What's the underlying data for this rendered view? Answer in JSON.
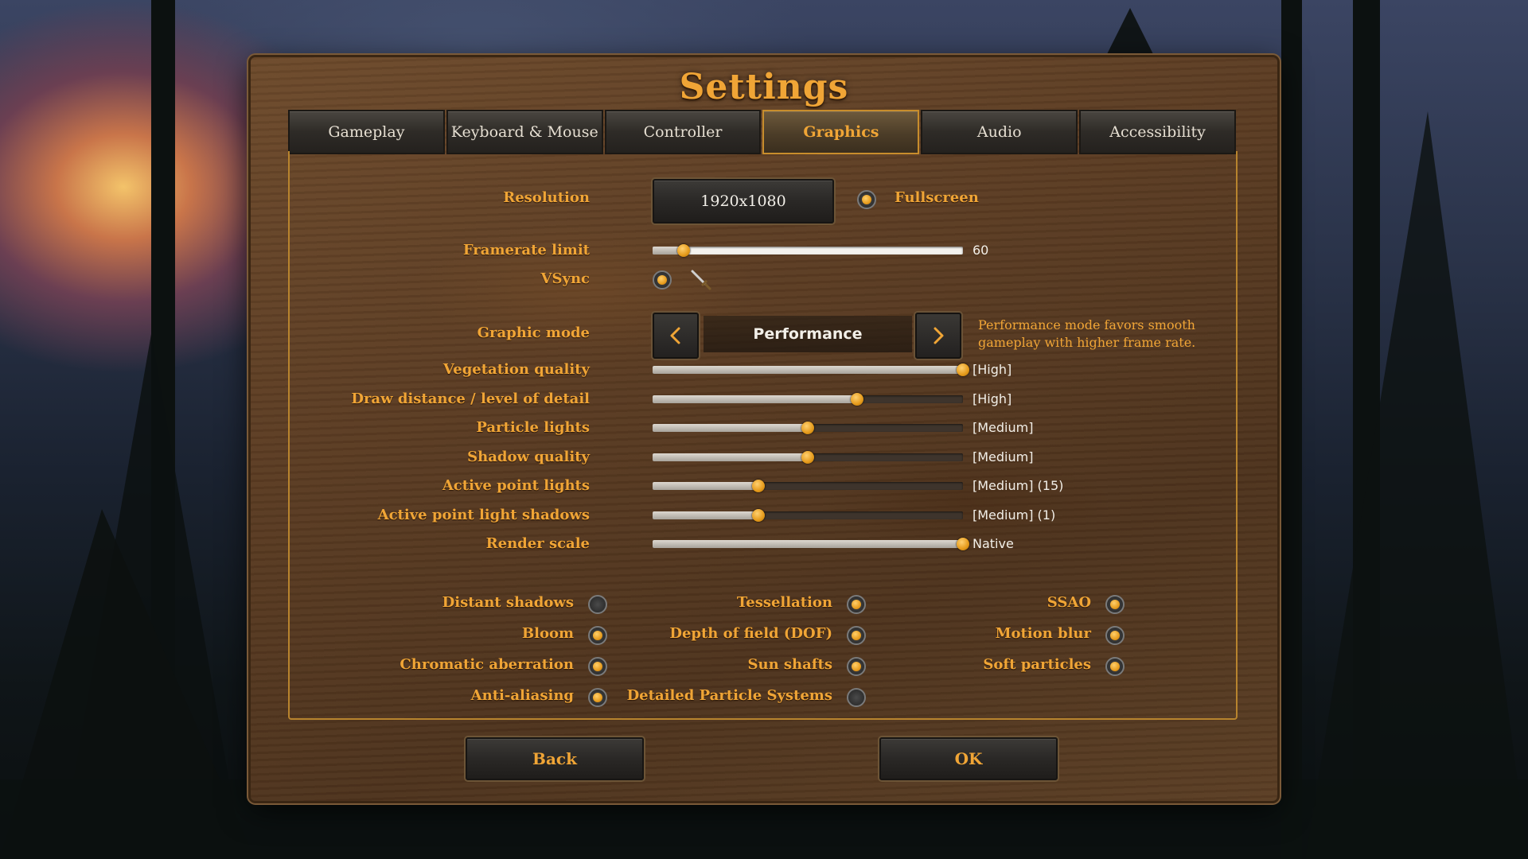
{
  "title": "Settings",
  "tabs": [
    {
      "label": "Gameplay"
    },
    {
      "label": "Keyboard & Mouse"
    },
    {
      "label": "Controller"
    },
    {
      "label": "Graphics"
    },
    {
      "label": "Audio"
    },
    {
      "label": "Accessibility"
    }
  ],
  "active_tab": "Graphics",
  "resolution": {
    "label": "Resolution",
    "value": "1920x1080"
  },
  "fullscreen": {
    "label": "Fullscreen",
    "on": true
  },
  "framerate": {
    "label": "Framerate limit",
    "value": "60",
    "fraction": 0.1
  },
  "vsync": {
    "label": "VSync",
    "on": true
  },
  "graphic_mode": {
    "label": "Graphic mode",
    "value": "Performance",
    "description_line1": "Performance mode favors smooth",
    "description_line2": "gameplay with higher frame rate."
  },
  "quality_sliders": [
    {
      "label": "Vegetation quality",
      "value": "[High]",
      "fraction": 1.0
    },
    {
      "label": "Draw distance / level of detail",
      "value": "[High]",
      "fraction": 0.66
    },
    {
      "label": "Particle lights",
      "value": "[Medium]",
      "fraction": 0.5
    },
    {
      "label": "Shadow quality",
      "value": "[Medium]",
      "fraction": 0.5
    },
    {
      "label": "Active point lights",
      "value": "[Medium] (15)",
      "fraction": 0.34
    },
    {
      "label": "Active point light shadows",
      "value": "[Medium] (1)",
      "fraction": 0.34
    },
    {
      "label": "Render scale",
      "value": "Native",
      "fraction": 1.0
    }
  ],
  "toggles": [
    {
      "label": "Distant shadows",
      "on": false
    },
    {
      "label": "Tessellation",
      "on": true
    },
    {
      "label": "SSAO",
      "on": true
    },
    {
      "label": "Bloom",
      "on": true
    },
    {
      "label": "Depth of field (DOF)",
      "on": true
    },
    {
      "label": "Motion blur",
      "on": true
    },
    {
      "label": "Chromatic aberration",
      "on": true
    },
    {
      "label": "Sun shafts",
      "on": true
    },
    {
      "label": "Soft particles",
      "on": true
    },
    {
      "label": "Anti-aliasing",
      "on": true
    },
    {
      "label": "Detailed Particle Systems",
      "on": false
    }
  ],
  "buttons": {
    "back": "Back",
    "ok": "OK"
  },
  "colors": {
    "accent": "#f0a536",
    "value_text": "#f2efe8",
    "wood": "#5a3b22"
  },
  "icons": {
    "prev": "chevron-left-icon",
    "next": "chevron-right-icon",
    "cursor": "sword-cursor-icon"
  }
}
